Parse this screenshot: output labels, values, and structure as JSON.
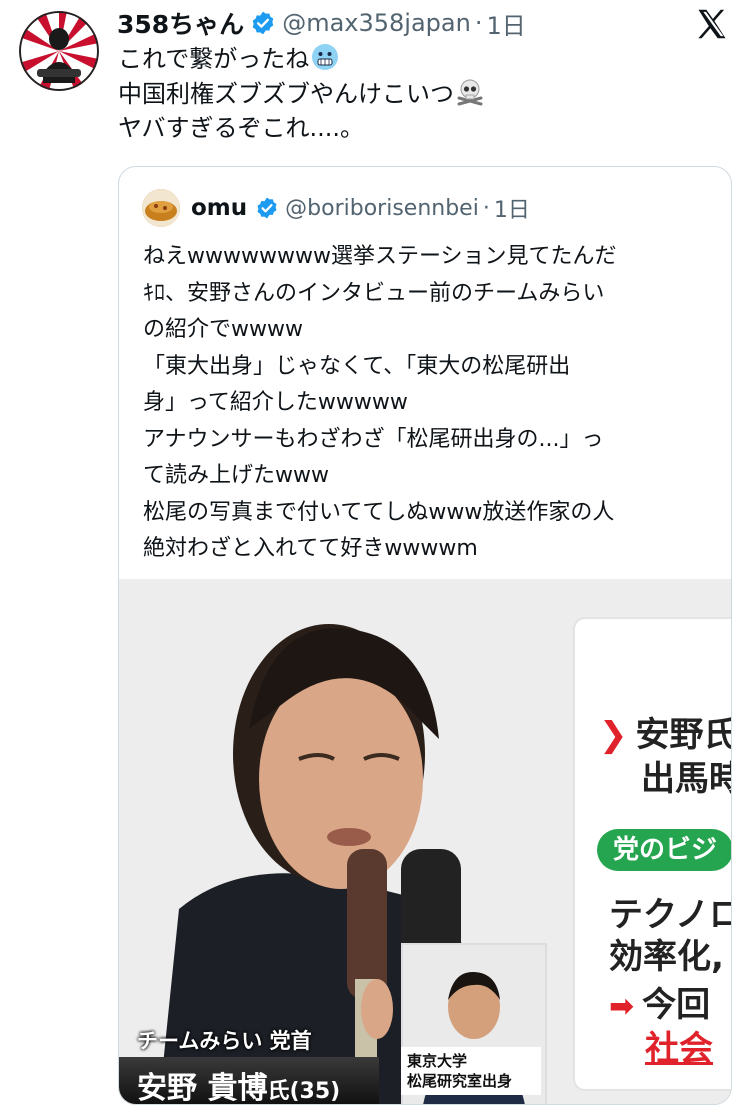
{
  "tweet": {
    "author_name": "358ちゃん",
    "author_handle": "@max358japan",
    "separator": "·",
    "time": "1日",
    "lines": [
      "これで繋がったね",
      "中国利権ズブズブやんけこいつ",
      "ヤバすぎるぞこれ....。"
    ],
    "emojis": [
      "cold-face-emoji",
      "skull-crossbones-emoji"
    ]
  },
  "quote": {
    "author_name": "omu",
    "author_handle": "@boriborisennbei",
    "separator": "·",
    "time": "1日",
    "lines": [
      "ねえwwwwwwww選挙ステーション見てたんだ",
      "ｷﾛ、安野さんのインタビュー前のチームみらい",
      "の紹介でwwww",
      "「東大出身」じゃなくて、「東大の松尾研出",
      "身」って紹介したwwwww",
      "アナウンサーもわざわざ「松尾研出身の...」っ",
      "て読み上げたwww",
      "松尾の写真まで付いててしぬwww放送作家の人",
      "絶対わざと入れてて好きwwwwm"
    ]
  },
  "photo": {
    "panel_line1": "安野氏",
    "panel_line2": "出馬時",
    "panel_badge": "党のビジ",
    "panel_line3": "テクノロ",
    "panel_line4": "効率化,",
    "panel_line5": "今回",
    "panel_line6": "社会",
    "caption_party": "チームみらい 党首",
    "caption_name": "安野 貴博",
    "caption_suffix": "氏(35)",
    "inset_line1": "東京大学",
    "inset_line2": "松尾研究室出身"
  },
  "colors": {
    "verified": "#1d9bf0",
    "text": "#0f1419",
    "muted": "#536471",
    "border": "#cfd9de",
    "tv_red": "#e0222a",
    "tv_green": "#25a54f"
  },
  "icons": {
    "verified": "verified-badge-icon",
    "platform": "x-logo-icon"
  }
}
